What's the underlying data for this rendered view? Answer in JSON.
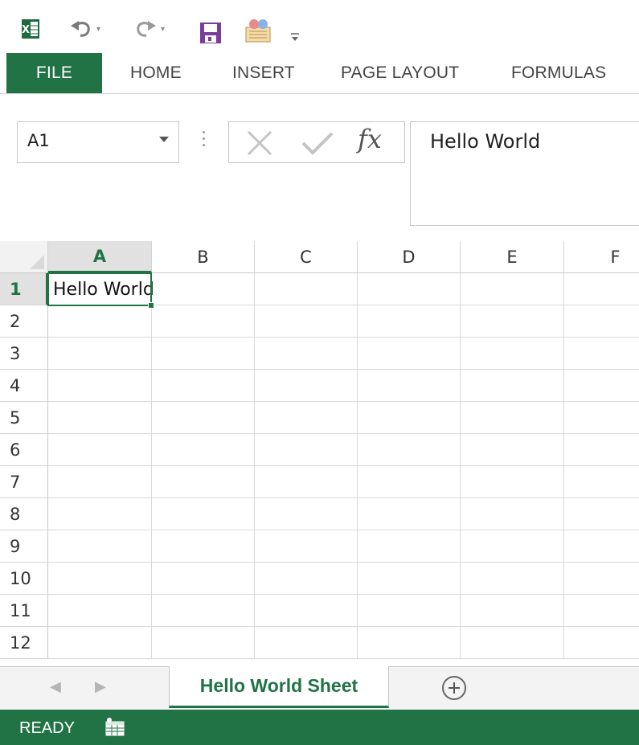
{
  "app_icon": "excel-logo",
  "quick_access": {
    "undo_icon": "undo-icon",
    "redo_icon": "redo-icon",
    "save_icon": "save-icon",
    "touch_icon": "touch-mode-icon",
    "customize_glyph": "₹"
  },
  "ribbon": {
    "tabs": [
      "FILE",
      "HOME",
      "INSERT",
      "PAGE LAYOUT",
      "FORMULAS"
    ]
  },
  "formula_bar": {
    "name_box": "A1",
    "fx_label": "fx",
    "content": "Hello World"
  },
  "grid": {
    "columns": [
      "A",
      "B",
      "C",
      "D",
      "E",
      "F"
    ],
    "selected_column": "A",
    "rows": [
      "1",
      "2",
      "3",
      "4",
      "5",
      "6",
      "7",
      "8",
      "9",
      "10",
      "11",
      "12"
    ],
    "selected_row": "1",
    "cells": {
      "A1": "Hello World"
    }
  },
  "sheet_tabs": {
    "prev": "◀",
    "next": "▶",
    "active": "Hello World Sheet",
    "new_sheet_icon": "plus-circle-icon"
  },
  "status_bar": {
    "mode": "READY",
    "macro_icon": "macro-record-icon"
  },
  "colors": {
    "accent": "#217346",
    "status_bg": "#217346"
  }
}
